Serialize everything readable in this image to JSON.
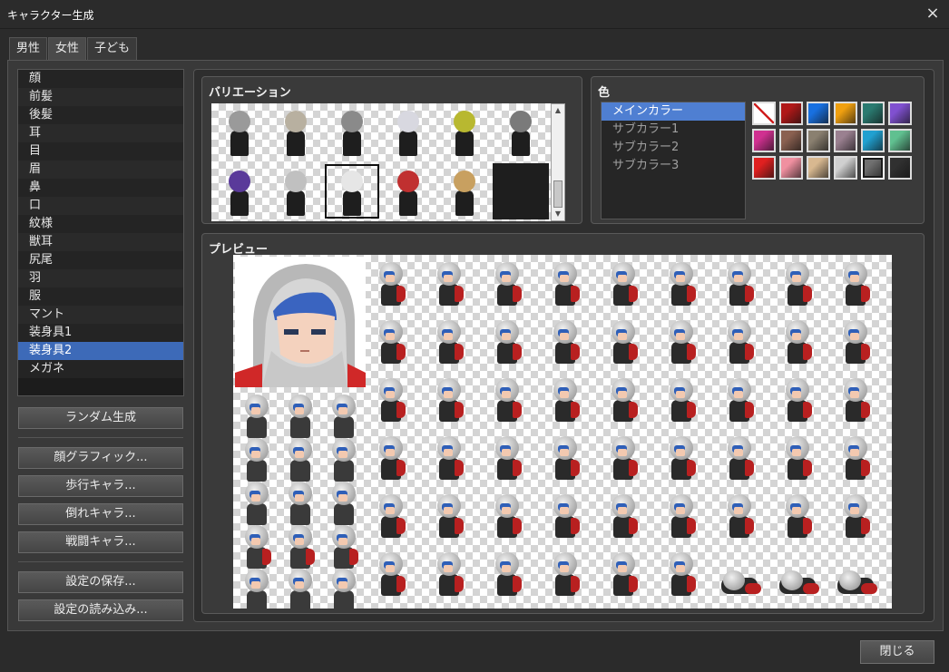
{
  "window": {
    "title": "キャラクター生成",
    "close_icon": "×"
  },
  "tabs": [
    {
      "label": "男性",
      "active": false
    },
    {
      "label": "女性",
      "active": true
    },
    {
      "label": "子ども",
      "active": false
    }
  ],
  "parts": {
    "selected_index": 15,
    "items": [
      "顔",
      "前髪",
      "後髪",
      "耳",
      "目",
      "眉",
      "鼻",
      "口",
      "紋様",
      "獣耳",
      "尻尾",
      "羽",
      "服",
      "マント",
      "装身具1",
      "装身具2",
      "メガネ"
    ]
  },
  "buttons": {
    "random": "ランダム生成",
    "face_graphic": "顔グラフィック...",
    "walk_char": "歩行キャラ...",
    "fallen_char": "倒れキャラ...",
    "battle_char": "戦闘キャラ...",
    "save_settings": "設定の保存...",
    "load_settings": "設定の読み込み...",
    "close": "閉じる"
  },
  "variation": {
    "label": "バリエーション",
    "selected_index": 8,
    "item_colors": [
      "#9a9a9a",
      "#b8b0a0",
      "#8a8a8a",
      "#d8d8e0",
      "#b8b830",
      "#7a7a7a",
      "#5a3a9a",
      "#c0c0c0",
      "#e6e6e6",
      "#c03030",
      "#c8a060",
      "#1e1e1e"
    ]
  },
  "color": {
    "label": "色",
    "items": [
      {
        "label": "メインカラー",
        "selected": true
      },
      {
        "label": "サブカラー1",
        "selected": false
      },
      {
        "label": "サブカラー2",
        "selected": false
      },
      {
        "label": "サブカラー3",
        "selected": false
      }
    ],
    "swatches": [
      "none",
      "#b01818",
      "#1870e0",
      "#f0a010",
      "#2a7a70",
      "#8050d0",
      "#d03090",
      "#8a6050",
      "#8a8070",
      "#9a8090",
      "#20a0d0",
      "#60c090",
      "#e02020",
      "#f090a0",
      "#d8b890",
      "#d0d0d0",
      "#707070",
      "#303030"
    ],
    "selected_swatch": 16
  },
  "preview": {
    "label": "プレビュー"
  }
}
